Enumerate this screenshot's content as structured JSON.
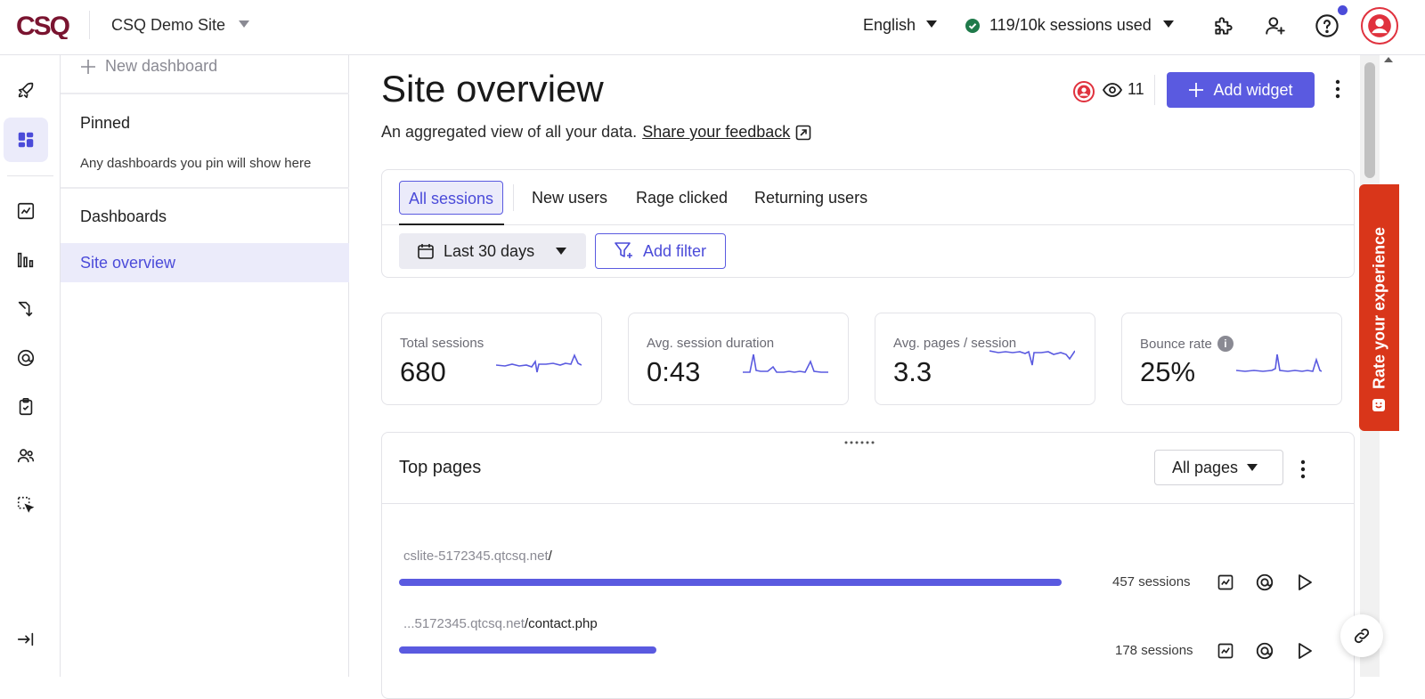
{
  "header": {
    "logo_text": "CSQ",
    "site_name": "CSQ Demo Site",
    "language": "English",
    "sessions_used": "119/10k sessions used",
    "icons": [
      "puzzle-icon",
      "add-user-icon",
      "help-icon",
      "user-avatar-icon"
    ]
  },
  "rail": {
    "items": [
      "rocket-icon",
      "dashboard-icon",
      "trend-chart-icon",
      "bar-chart-icon",
      "journey-icon",
      "zone-icon",
      "checklist-icon",
      "users-icon",
      "selection-icon",
      "collapse-icon"
    ],
    "active": "dashboard-icon"
  },
  "dashboards_panel": {
    "new_dashboard_label": "New dashboard",
    "pinned_heading": "Pinned",
    "pinned_empty_text": "Any dashboards you pin will show here",
    "dashboards_heading": "Dashboards",
    "items": [
      {
        "label": "Site overview",
        "active": true
      }
    ]
  },
  "main": {
    "title": "Site overview",
    "subtitle": "An aggregated view of all your data.",
    "feedback_link": "Share your feedback",
    "viewers_count": "11",
    "add_widget_label": "Add widget",
    "segments": [
      {
        "label": "All sessions",
        "active": true
      },
      {
        "label": "New users",
        "active": false
      },
      {
        "label": "Rage clicked",
        "active": false
      },
      {
        "label": "Returning users",
        "active": false
      }
    ],
    "date_range": "Last 30 days",
    "add_filter_label": "Add filter",
    "kpis": [
      {
        "label": "Total sessions",
        "value": "680",
        "info": false
      },
      {
        "label": "Avg. session duration",
        "value": "0:43",
        "info": false
      },
      {
        "label": "Avg. pages / session",
        "value": "3.3",
        "info": false
      },
      {
        "label": "Bounce rate",
        "value": "25%",
        "info": true
      }
    ],
    "top_pages": {
      "title": "Top pages",
      "filter_value": "All pages",
      "rows": [
        {
          "domain": "cslite-5172345.qtcsq.net",
          "path": "/",
          "sessions": "457 sessions",
          "share": 1.0
        },
        {
          "domain": "...5172345.qtcsq.net",
          "path": "/contact.php",
          "sessions": "178 sessions",
          "share": 0.389
        }
      ]
    }
  },
  "feedback_tab": {
    "label": "Rate your experience"
  },
  "colors": {
    "brand": "#7a1430",
    "accent": "#5a5ae0",
    "accent_text": "#4b4bd9",
    "active_bg": "#ebebfa",
    "success": "#1f7a4a",
    "feedback_tab": "#d9361a",
    "avatar_ring": "#e0323e"
  }
}
